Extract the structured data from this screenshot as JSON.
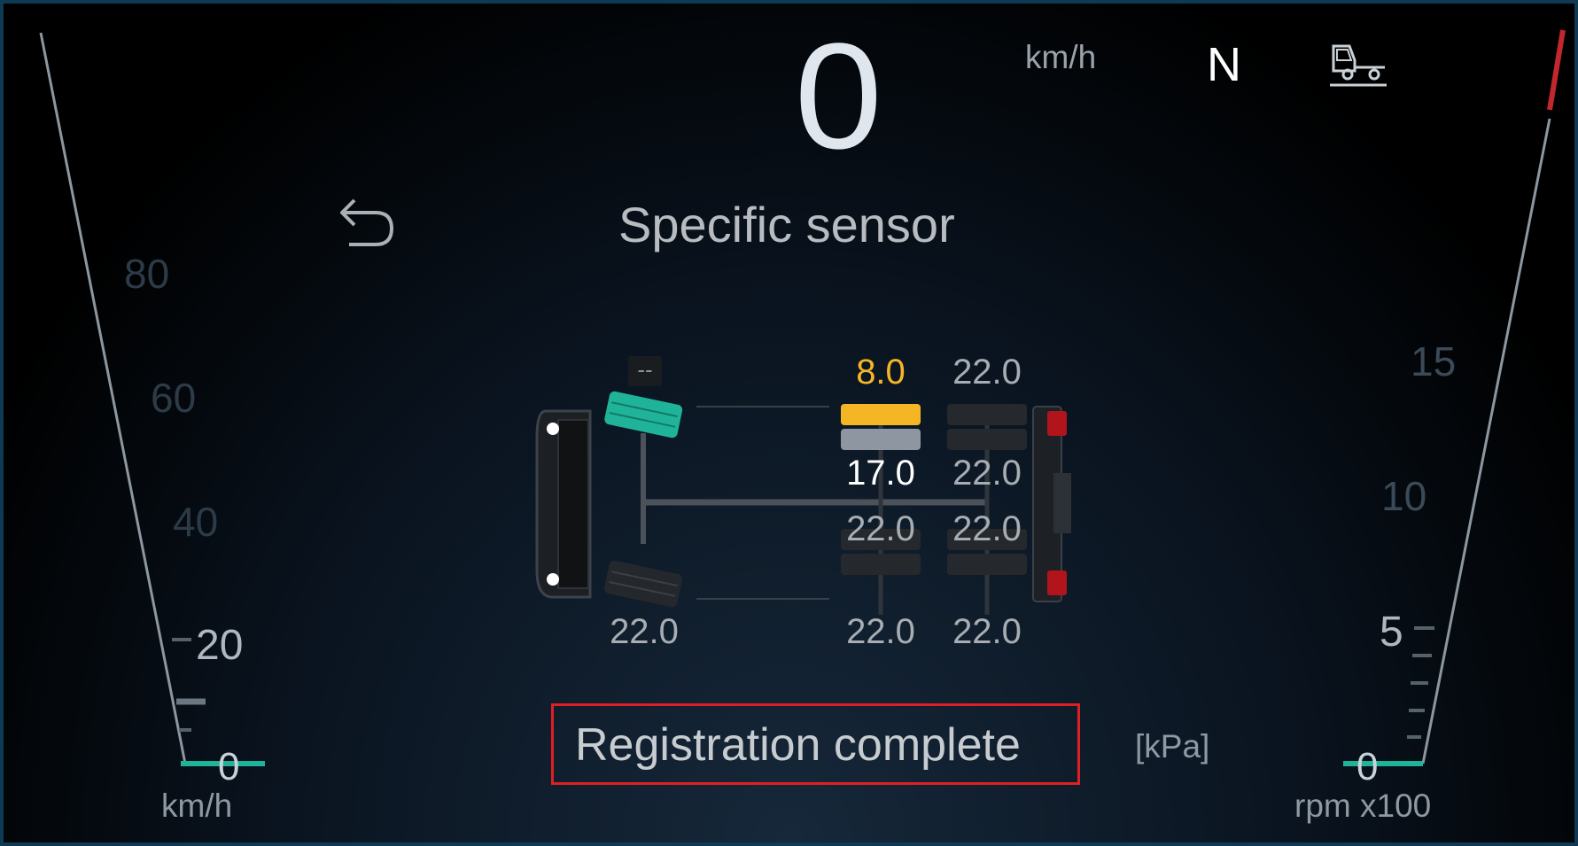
{
  "header": {
    "speed_value": "0",
    "speed_unit": "km/h",
    "gear": "N",
    "trailer_icon": "tow-trailer-icon"
  },
  "screen": {
    "title": "Specific sensor",
    "back_icon": "back-arrow-icon"
  },
  "speed_gauge": {
    "ticks": [
      "80",
      "60",
      "40",
      "20"
    ],
    "zero": "0",
    "unit": "km/h",
    "needle_color": "#1fb49a"
  },
  "rpm_gauge": {
    "ticks": [
      "15",
      "10",
      "5"
    ],
    "zero": "0",
    "unit": "rpm x100",
    "redline_color": "#c0282e"
  },
  "tires": {
    "front_left": "--",
    "front_right": "22.0",
    "axle2_outer_left": "8.0",
    "axle2_inner_left": "17.0",
    "axle2_inner_right": "22.0",
    "axle2_outer_right": "22.0",
    "axle3_outer_left": "22.0",
    "axle3_inner_left": "22.0",
    "axle3_inner_right": "22.0",
    "axle3_outer_right": "22.0",
    "selected_color": "#1fb49a",
    "warning_color": "#f5b626"
  },
  "footer": {
    "status": "Registration complete",
    "unit": "[kPa]"
  }
}
